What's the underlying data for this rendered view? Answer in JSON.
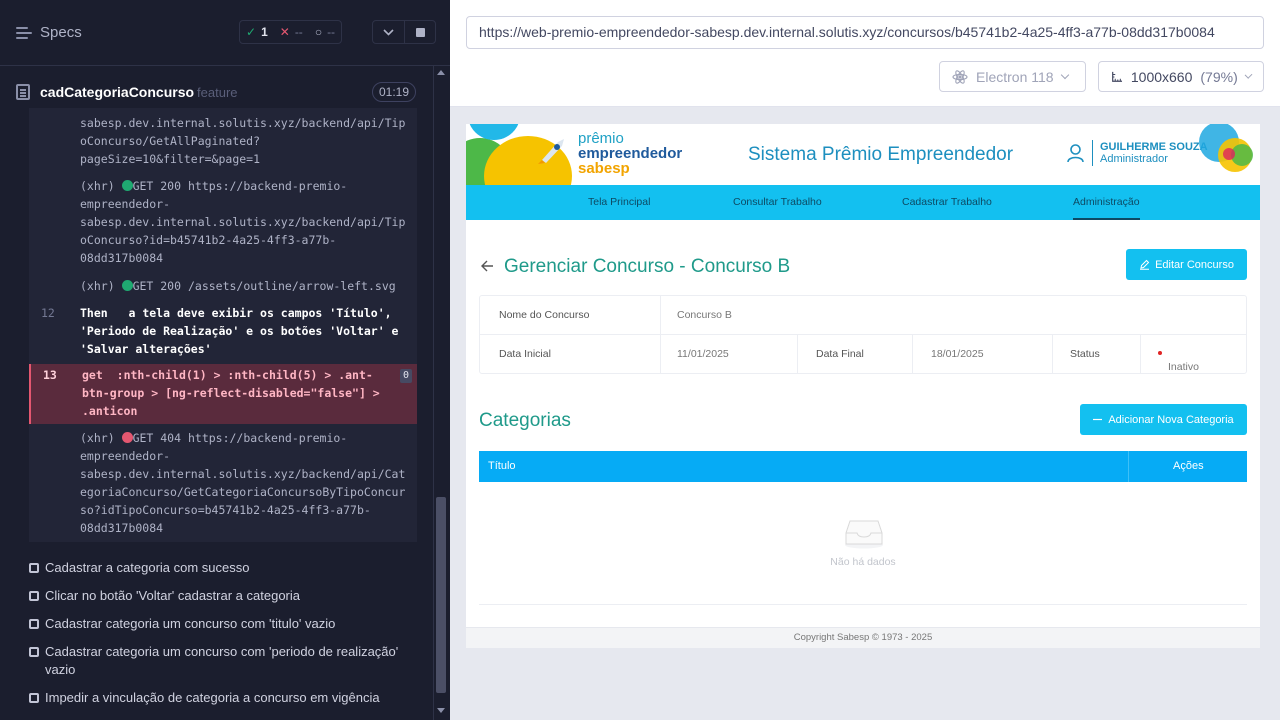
{
  "reporter": {
    "specs_label": "Specs",
    "passed": "1",
    "failed": "--",
    "pending": "--",
    "spec_name": "cadCategoriaConcurso",
    "spec_type": "feature",
    "duration": "01:19",
    "log_lines": [
      "sabesp.dev.internal.solutis.xyz/backend/api/Tip",
      "oConcurso/GetAllPaginated?",
      "pageSize=10&filter=&page=1"
    ],
    "xhr1": {
      "prefix": "(xhr)",
      "status": "GET 200",
      "lines": [
        "https://backend-premio-",
        "empreendedor-",
        "sabesp.dev.internal.solutis.xyz/backend/api/Tip",
        "oConcurso?id=b45741b2-4a25-4ff3-a77b-",
        "08dd317b0084"
      ]
    },
    "xhr2": {
      "prefix": "(xhr)",
      "status": "GET 200",
      "url": "/assets/outline/arrow-left.svg"
    },
    "step12": {
      "line": "12",
      "keyword": "Then",
      "lines": [
        "a tela deve exibir os campos 'Título',",
        "'Periodo de Realização' e os botões 'Voltar' e",
        "'Salvar alterações'"
      ]
    },
    "step13": {
      "line": "13",
      "keyword": "get",
      "lines": [
        ":nth-child(1) > :nth-child(5) > .ant-",
        "btn-group > [ng-reflect-disabled=\"false\"] >",
        ".anticon"
      ],
      "badge": "0"
    },
    "xhr3": {
      "prefix": "(xhr)",
      "status": "GET 404",
      "lines": [
        "https://backend-premio-",
        "empreendedor-",
        "sabesp.dev.internal.solutis.xyz/backend/api/Cat",
        "egoriaConcurso/GetCategoriaConcursoByTipoConcur",
        "so?idTipoConcurso=b45741b2-4a25-4ff3-a77b-",
        "08dd317b0084"
      ]
    },
    "tests": [
      "Cadastrar a categoria com sucesso",
      "Clicar no botão 'Voltar' cadastrar a categoria",
      "Cadastrar categoria um concurso com 'titulo' vazio",
      "Cadastrar categoria um concurso com 'periodo de realização' vazio",
      "Impedir a vinculação de categoria a concurso em vigência"
    ]
  },
  "browser": {
    "url": "https://web-premio-empreendedor-sabesp.dev.internal.solutis.xyz/concursos/b45741b2-4a25-4ff3-a77b-08dd317b0084",
    "browser_name": "Electron 118",
    "viewport": "1000x660",
    "zoom": "(79%)"
  },
  "app": {
    "logo": [
      "prêmio",
      "empreendedor",
      "sabesp"
    ],
    "system_title": "Sistema Prêmio Empreendedor",
    "user_name": "GUILHERME SOUZA",
    "user_role": "Administrador",
    "nav": [
      "Tela Principal",
      "Consultar Trabalho",
      "Cadastrar Trabalho",
      "Administração"
    ],
    "page_title": "Gerenciar Concurso - Concurso B",
    "edit_button": "Editar Concurso",
    "info": {
      "name_label": "Nome do Concurso",
      "name_value": "Concurso B",
      "start_label": "Data Inicial",
      "start_value": "11/01/2025",
      "end_label": "Data Final",
      "end_value": "18/01/2025",
      "status_label": "Status",
      "status_value": "Inativo"
    },
    "categories_title": "Categorias",
    "add_button": "Adicionar Nova Categoria",
    "table_headers": [
      "Título",
      "Ações"
    ],
    "empty_text": "Não há dados",
    "footer": "Copyright Sabesp © 1973 - 2025"
  },
  "colors": {
    "reporter_bg": "#1b1e2e",
    "pass_green": "#1fa971",
    "fail_red": "#e45770",
    "nav_blue": "#13c0f0",
    "title_teal": "#1f9a8a"
  }
}
